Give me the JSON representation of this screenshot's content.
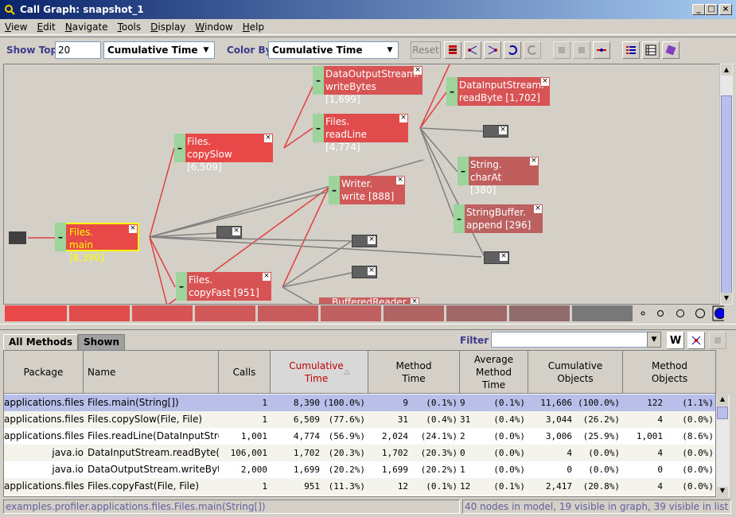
{
  "window": {
    "title": "Call Graph: snapshot_1"
  },
  "menu": [
    "View",
    "Edit",
    "Navigate",
    "Tools",
    "Display",
    "Window",
    "Help"
  ],
  "toolbar": {
    "show_top_label": "Show Top:",
    "show_top_value": "20",
    "sort_combo": "Cumulative Time",
    "color_by_label": "Color By:",
    "color_by_combo": "Cumulative Time",
    "reset_label": "Reset"
  },
  "graph": {
    "nodes": [
      {
        "id": "main",
        "line1": "Files.",
        "line2": "main [8,390]"
      },
      {
        "id": "copySlow",
        "line1": "Files.",
        "line2": "copySlow [6,509]"
      },
      {
        "id": "copyFast",
        "line1": "Files.",
        "line2": "copyFast [951]"
      },
      {
        "id": "dosWrite",
        "line1": "DataOutputStream.",
        "line2": "writeBytes [1,699]"
      },
      {
        "id": "readLine",
        "line1": "Files.",
        "line2": "readLine [4,774]"
      },
      {
        "id": "writer",
        "line1": "Writer.",
        "line2": "write [888]"
      },
      {
        "id": "disRead",
        "line1": "DataInputStream.",
        "line2": "readByte [1,702]"
      },
      {
        "id": "charAt",
        "line1": "String.",
        "line2": "charAt [380]"
      },
      {
        "id": "sbAppend",
        "line1": "StringBuffer.",
        "line2": "append [296]"
      },
      {
        "id": "buffered",
        "line1": "BufferedReader",
        "line2": ""
      }
    ]
  },
  "colors": {
    "hot": "#e8484c",
    "warm": "#d85454",
    "selected_border": "#ffff00",
    "selected_text": "#ffff00"
  },
  "tabs": [
    "All Methods",
    "Shown"
  ],
  "filter": {
    "label": "Filter :"
  },
  "table": {
    "headers": [
      "Package",
      "Name",
      "Calls",
      "Cumulative Time",
      "Method Time",
      "Average Method Time",
      "Cumulative Objects",
      "Method Objects"
    ],
    "rows": [
      {
        "pkg": "applications.files",
        "name": "Files.main(String[])",
        "calls": "1",
        "cum": "8,390",
        "cump": "(100.0%)",
        "mt": "9",
        "mtp": "(0.1%)",
        "amt": "9",
        "amtp": "(0.1%)",
        "co": "11,606",
        "cop": "(100.0%)",
        "mo": "122",
        "mop": "(1.1%)"
      },
      {
        "pkg": "applications.files",
        "name": "Files.copySlow(File, File)",
        "calls": "1",
        "cum": "6,509",
        "cump": "(77.6%)",
        "mt": "31",
        "mtp": "(0.4%)",
        "amt": "31",
        "amtp": "(0.4%)",
        "co": "3,044",
        "cop": "(26.2%)",
        "mo": "4",
        "mop": "(0.0%)"
      },
      {
        "pkg": "applications.files",
        "name": "Files.readLine(DataInputStre",
        "calls": "1,001",
        "cum": "4,774",
        "cump": "(56.9%)",
        "mt": "2,024",
        "mtp": "(24.1%)",
        "amt": "2",
        "amtp": "(0.0%)",
        "co": "3,006",
        "cop": "(25.9%)",
        "mo": "1,001",
        "mop": "(8.6%)"
      },
      {
        "pkg": "java.io",
        "name": "DataInputStream.readByte()",
        "calls": "106,001",
        "cum": "1,702",
        "cump": "(20.3%)",
        "mt": "1,702",
        "mtp": "(20.3%)",
        "amt": "0",
        "amtp": "(0.0%)",
        "co": "4",
        "cop": "(0.0%)",
        "mo": "4",
        "mop": "(0.0%)"
      },
      {
        "pkg": "java.io",
        "name": "DataOutputStream.writeByte",
        "calls": "2,000",
        "cum": "1,699",
        "cump": "(20.2%)",
        "mt": "1,699",
        "mtp": "(20.2%)",
        "amt": "1",
        "amtp": "(0.0%)",
        "co": "0",
        "cop": "(0.0%)",
        "mo": "0",
        "mop": "(0.0%)"
      },
      {
        "pkg": "applications.files",
        "name": "Files.copyFast(File, File)",
        "calls": "1",
        "cum": "951",
        "cump": "(11.3%)",
        "mt": "12",
        "mtp": "(0.1%)",
        "amt": "12",
        "amtp": "(0.1%)",
        "co": "2,417",
        "cop": "(20.8%)",
        "mo": "4",
        "mop": "(0.0%)"
      }
    ]
  },
  "status": {
    "left": "examples.profiler.applications.files.Files.main(String[])",
    "right": "40 nodes in model, 19 visible in graph, 39 visible in list"
  }
}
